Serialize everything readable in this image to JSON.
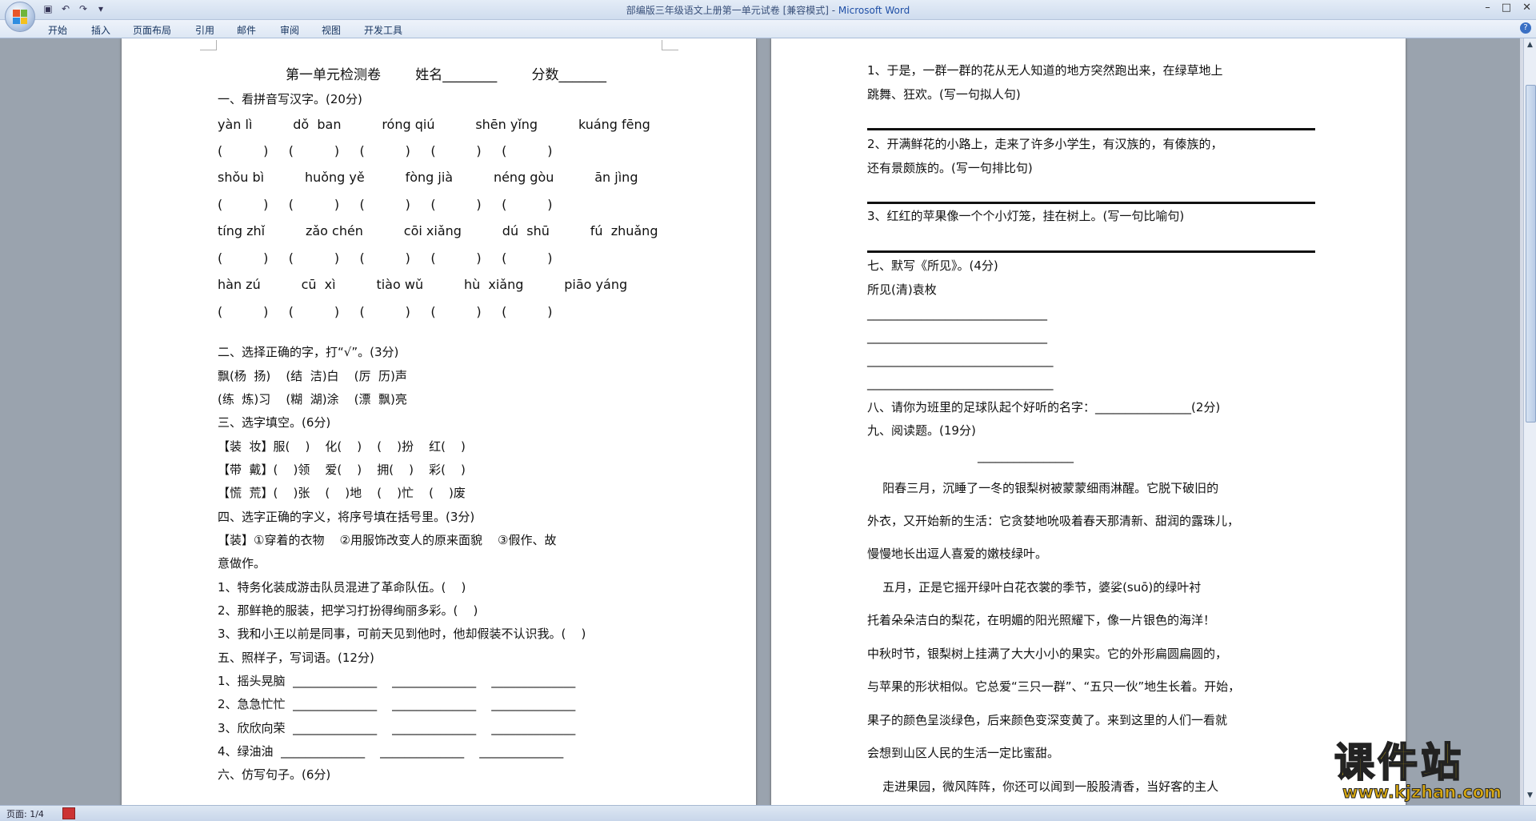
{
  "window": {
    "title_doc": "部编版三年级语文上册第一单元试卷 [兼容模式] - ",
    "title_app": "Microsoft Word",
    "ctl_min": "–",
    "ctl_max": "□",
    "ctl_close": "✕"
  },
  "menu": {
    "tabs": [
      "开始",
      "插入",
      "页面布局",
      "引用",
      "邮件",
      "审阅",
      "视图",
      "开发工具"
    ]
  },
  "status": {
    "page": "页面: 1/4"
  },
  "watermark": {
    "title": "课件站",
    "url": "www.kjzhan.com"
  },
  "page1": {
    "lines": [
      "第一单元检测卷        姓名________        分数_______",
      "一、看拼音写汉字。(20分)",
      "yàn lì          dǒ  ban          róng qiú          shēn yǐng          kuáng fēng",
      "(          )     (          )     (          )     (          )     (          )",
      "shǒu bì          huǒng yě          fòng jià          néng gòu          ān jìng",
      "(          )     (          )     (          )     (          )     (          )",
      "tíng zhǐ          zǎo chén          cōi xiǎng          dú  shū          fú  zhuǎng",
      "(          )     (          )     (          )     (          )     (          )",
      "hàn zú          cū  xì          tiào wǔ          hù  xiǎng          piāo yáng",
      "(          )     (          )     (          )     (          )     (          )",
      "",
      "二、选择正确的字，打“√”。(3分)",
      "飘(杨  扬)    (结  洁)白    (厉  历)声",
      "(练  炼)习    (糊  湖)涂    (漂  飘)亮",
      "三、选字填空。(6分)",
      "【装  妆】服(    )    化(    )    (    )扮    红(    )",
      "【带  戴】(    )领    爱(    )    拥(    )    彩(    )",
      "【慌  荒】(    )张    (    )地    (    )忙    (    )废",
      "四、选字正确的字义，将序号填在括号里。(3分)",
      "【装】①穿着的衣物    ②用服饰改变人的原来面貌    ③假作、故",
      "意做作。",
      "1、特务化装成游击队员混进了革命队伍。(    )",
      "2、那鲜艳的服装，把学习打扮得绚丽多彩。(    )",
      "3、我和小王以前是同事，可前天见到他时，他却假装不认识我。(    )",
      "五、照样子，写词语。(12分)",
      "1、摇头晃脑  ______________    ______________    ______________",
      "2、急急忙忙  ______________    ______________    ______________",
      "3、欣欣向荣  ______________    ______________    ______________",
      "4、绿油油  ______________    ______________    ______________",
      "六、仿写句子。(6分)"
    ]
  },
  "page2": {
    "lines": [
      "1、于是，一群一群的花从无人知道的地方突然跑出来，在绿草地上",
      "跳舞、狂欢。(写一句拟人句)",
      "",
      "2、开满鲜花的小路上，走来了许多小学生，有汉族的，有傣族的，",
      "还有景颇族的。(写一句排比句)",
      "",
      "3、红红的苹果像一个个小灯笼，挂在树上。(写一句比喻句)",
      "",
      "七、默写《所见》。(4分)",
      "所见(清)袁枚",
      "______________________________",
      "______________________________",
      "_______________________________",
      "_______________________________",
      "八、请你为班里的足球队起个好听的名字：________________(2分)",
      "九、阅读题。(19分)",
      "________________",
      "    阳春三月，沉睡了一冬的银梨树被蒙蒙细雨淋醒。它脱下破旧的",
      "外衣，又开始新的生活：它贪婪地吮吸着春天那清新、甜润的露珠儿，",
      "慢慢地长出逗人喜爱的嫩枝绿叶。",
      "    五月，正是它摇开绿叶白花衣裳的季节，婆娑(suō)的绿叶衬",
      "托着朵朵洁白的梨花，在明媚的阳光照耀下，像一片银色的海洋！",
      "中秋时节，银梨树上挂满了大大小小的果实。它的外形扁圆扁圆的，",
      "与苹果的形状相似。它总爱“三只一群”、“五只一伙”地生长着。开始，",
      "果子的颜色呈淡绿色，后来颜色变深变黄了。来到这里的人们一看就",
      "会想到山区人民的生活一定比蜜甜。",
      "    走进果园，微风阵阵，你还可以闻到一股股清香，当好客的主人"
    ]
  },
  "colors": {
    "accent": "#1f4fa6",
    "workspace": "#9aa3ae",
    "watermark_yellow": "#f5d21a"
  },
  "icons": [
    "office-button",
    "save-icon",
    "undo-icon",
    "redo-icon",
    "customize-icon",
    "help-icon",
    "scroll-up-icon",
    "scroll-down-icon"
  ]
}
